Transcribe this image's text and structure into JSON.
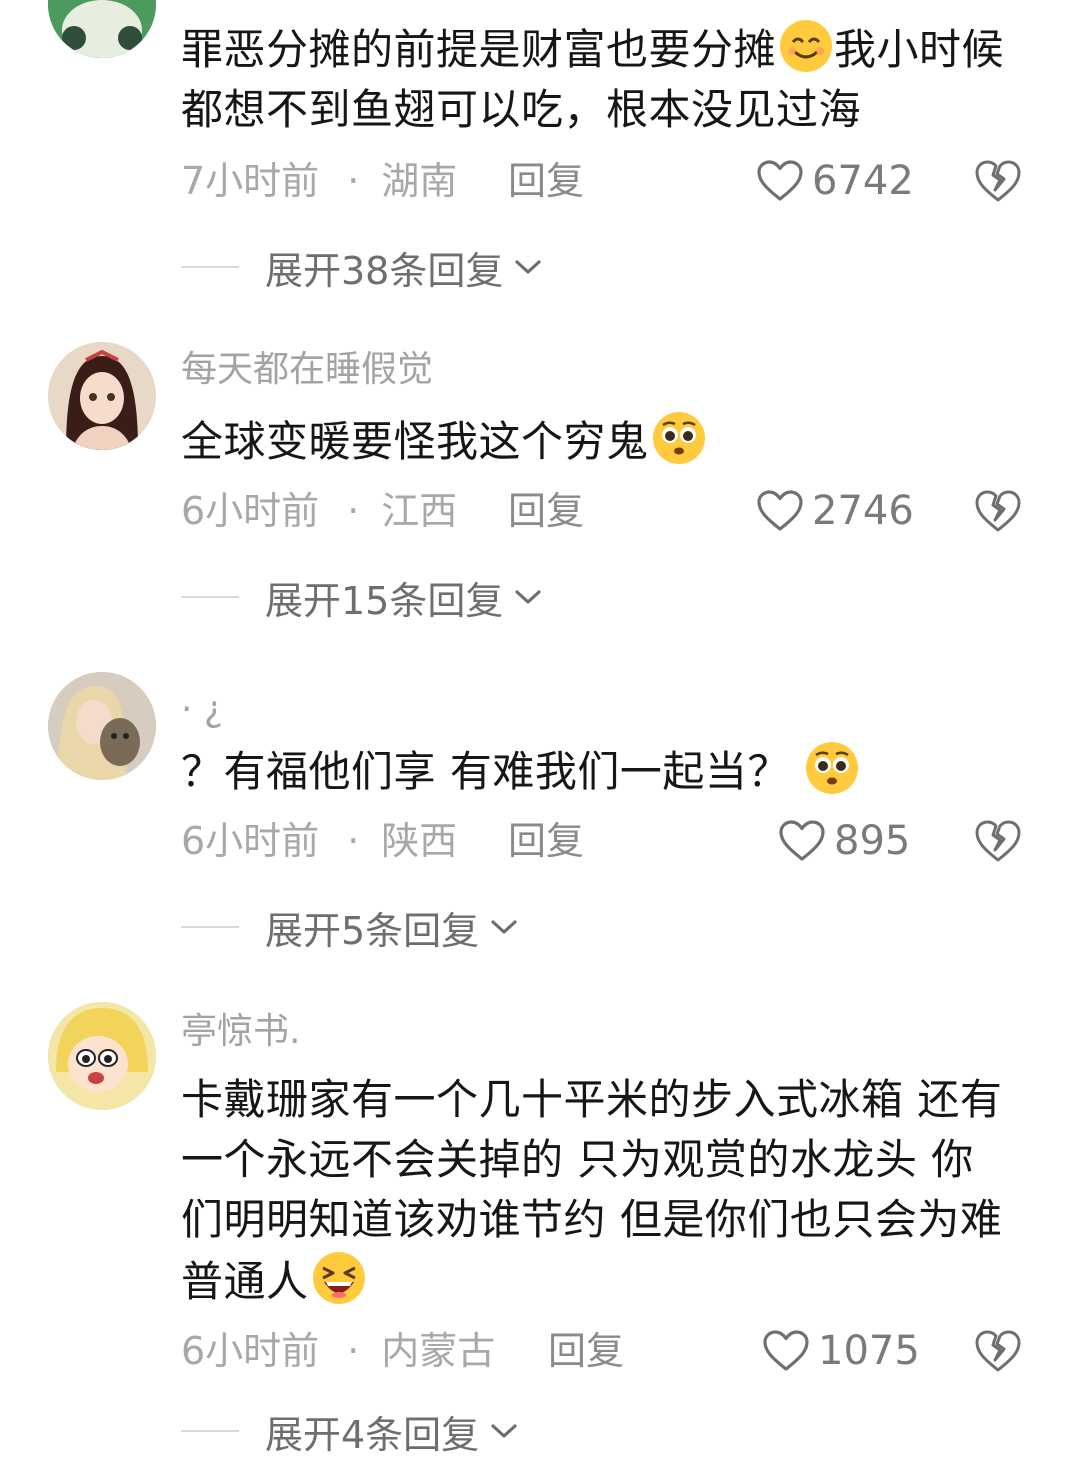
{
  "comments": [
    {
      "username": "",
      "text": "罪恶分摊的前提是财富也要分摊",
      "text_after_emoji": "我小时候都想不到鱼翅可以吃，根本没见过海",
      "emoji": "smiling-face-emoji",
      "time": "7小时前",
      "location": "湖南",
      "reply_label": "回复",
      "likes": "6742",
      "expand_label": "展开38条回复"
    },
    {
      "username": "每天都在睡假觉",
      "text": "全球变暖要怪我这个穷鬼",
      "emoji": "pleading-face-emoji",
      "time": "6小时前",
      "location": "江西",
      "reply_label": "回复",
      "likes": "2746",
      "expand_label": "展开15条回复"
    },
    {
      "username": "· ¿",
      "text": "？有福他们享 有难我们一起当？",
      "emoji": "pleading-face-emoji",
      "time": "6小时前",
      "location": "陕西",
      "reply_label": "回复",
      "likes": "895",
      "expand_label": "展开5条回复"
    },
    {
      "username": "亭惊书.",
      "text": "卡戴珊家有一个几十平米的步入式冰箱 还有一个永远不会关掉的 只为观赏的水龙头 你们明明知道该劝谁节约 但是你们也只会为难普通人",
      "emoji": "laughing-face-emoji",
      "time": "6小时前",
      "location": "内蒙古",
      "reply_label": "回复",
      "likes": "1075",
      "expand_label": "展开4条回复"
    }
  ],
  "colors": {
    "muted": "#a8a8a8",
    "text": "#161616"
  }
}
